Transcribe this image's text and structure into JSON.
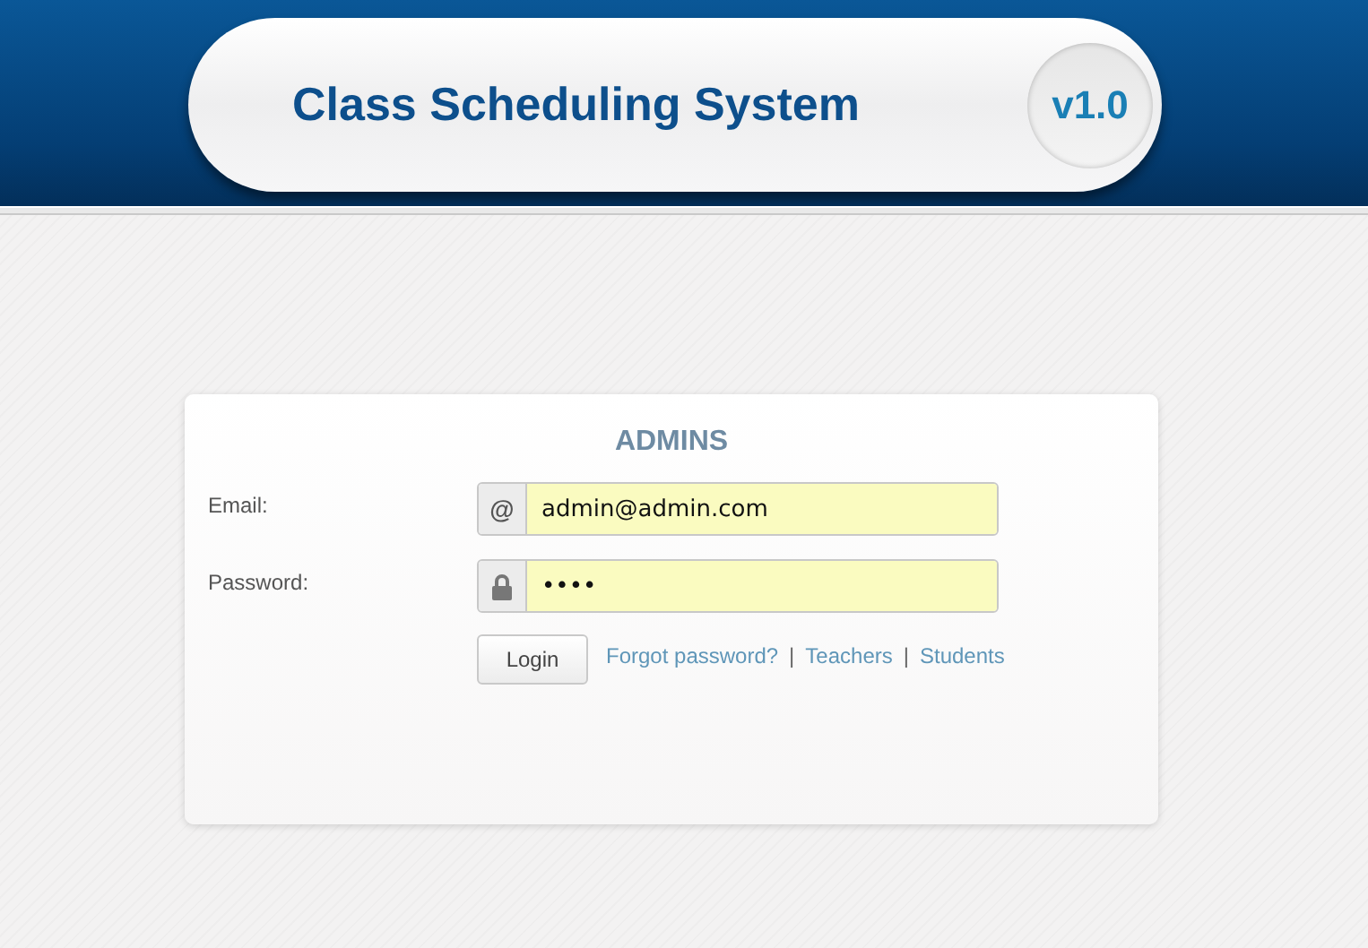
{
  "header": {
    "title": "Class Scheduling System",
    "version": "v1.0"
  },
  "form": {
    "heading": "ADMINS",
    "fields": [
      {
        "label": "Email:",
        "addon": {
          "kind": "text",
          "text": "@"
        },
        "value": "admin@admin.com"
      },
      {
        "label": "Password:",
        "addon": {
          "kind": "lock"
        },
        "value": "••••"
      }
    ],
    "button": "Login",
    "footer_items": [
      {
        "kind": "link",
        "text": "Forgot password?"
      },
      {
        "kind": "separator",
        "text": "|"
      },
      {
        "kind": "link",
        "text": "Teachers"
      },
      {
        "kind": "separator",
        "text": "|"
      },
      {
        "kind": "link",
        "text": "Students"
      }
    ]
  }
}
